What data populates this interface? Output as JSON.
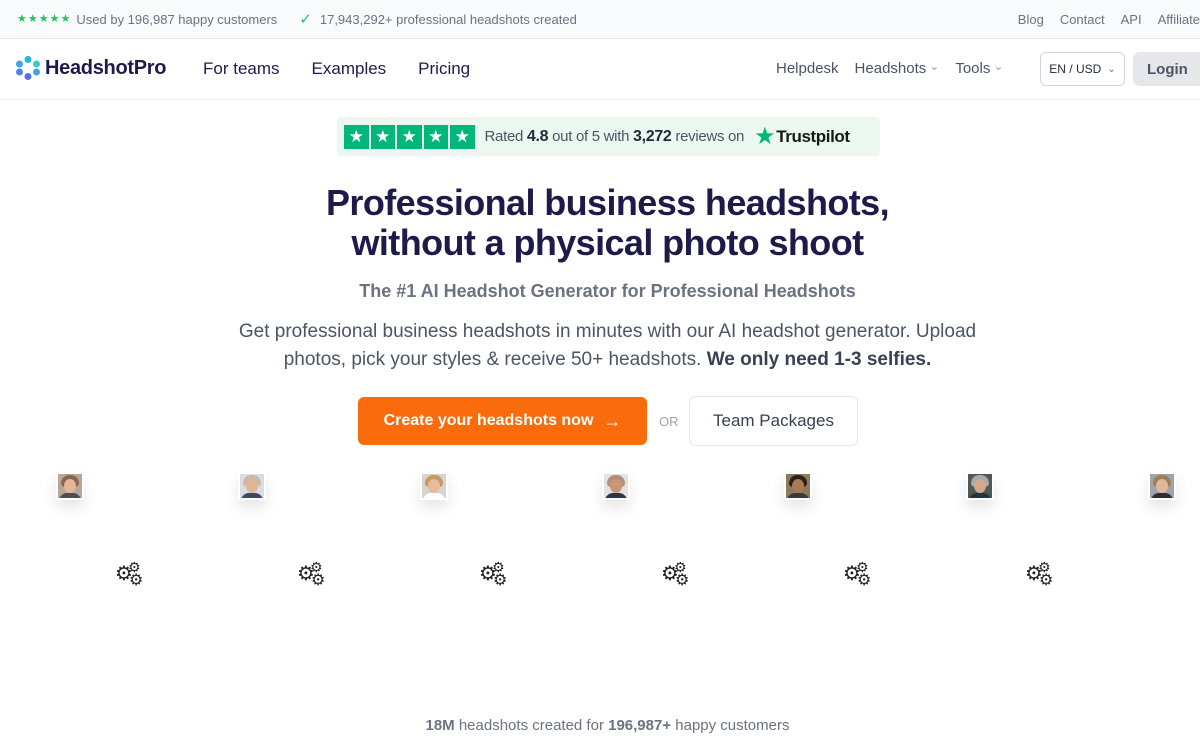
{
  "topbar": {
    "customers_text": "Used by 196,987 happy customers",
    "headshots_text": "17,943,292+ professional headshots created",
    "links": [
      "Blog",
      "Contact",
      "API",
      "Affiliate"
    ]
  },
  "nav": {
    "brand": "HeadshotPro",
    "main": [
      "For teams",
      "Examples",
      "Pricing"
    ],
    "helpdesk": "Helpdesk",
    "headshots": "Headshots",
    "tools": "Tools",
    "lang": "EN / USD",
    "login": "Login"
  },
  "trustpilot": {
    "rated": "Rated",
    "rating": "4.8",
    "out_of": "out of 5 with",
    "reviews": "3,272",
    "reviews_on": "reviews on",
    "brand": "Trustpilot"
  },
  "hero": {
    "title_line1": "Professional business headshots,",
    "title_line2": "without a physical photo shoot",
    "subtitle": "The #1 AI Headshot Generator for Professional Headshots",
    "desc_part1": "Get professional business headshots in minutes with our AI headshot generator. Upload photos, pick your styles & receive 50+ headshots.",
    "desc_bold": "We only need 1-3 selfies.",
    "cta": "Create your headshots now",
    "or": "OR",
    "team": "Team Packages"
  },
  "footer": {
    "count_bold": "18M",
    "mid": "headshots created for",
    "customers_bold": "196,987+",
    "end": "happy customers"
  },
  "colors": {
    "accent": "#f96b0b",
    "brand_dark": "#1e1b4b",
    "trustpilot_green": "#00b67a"
  }
}
